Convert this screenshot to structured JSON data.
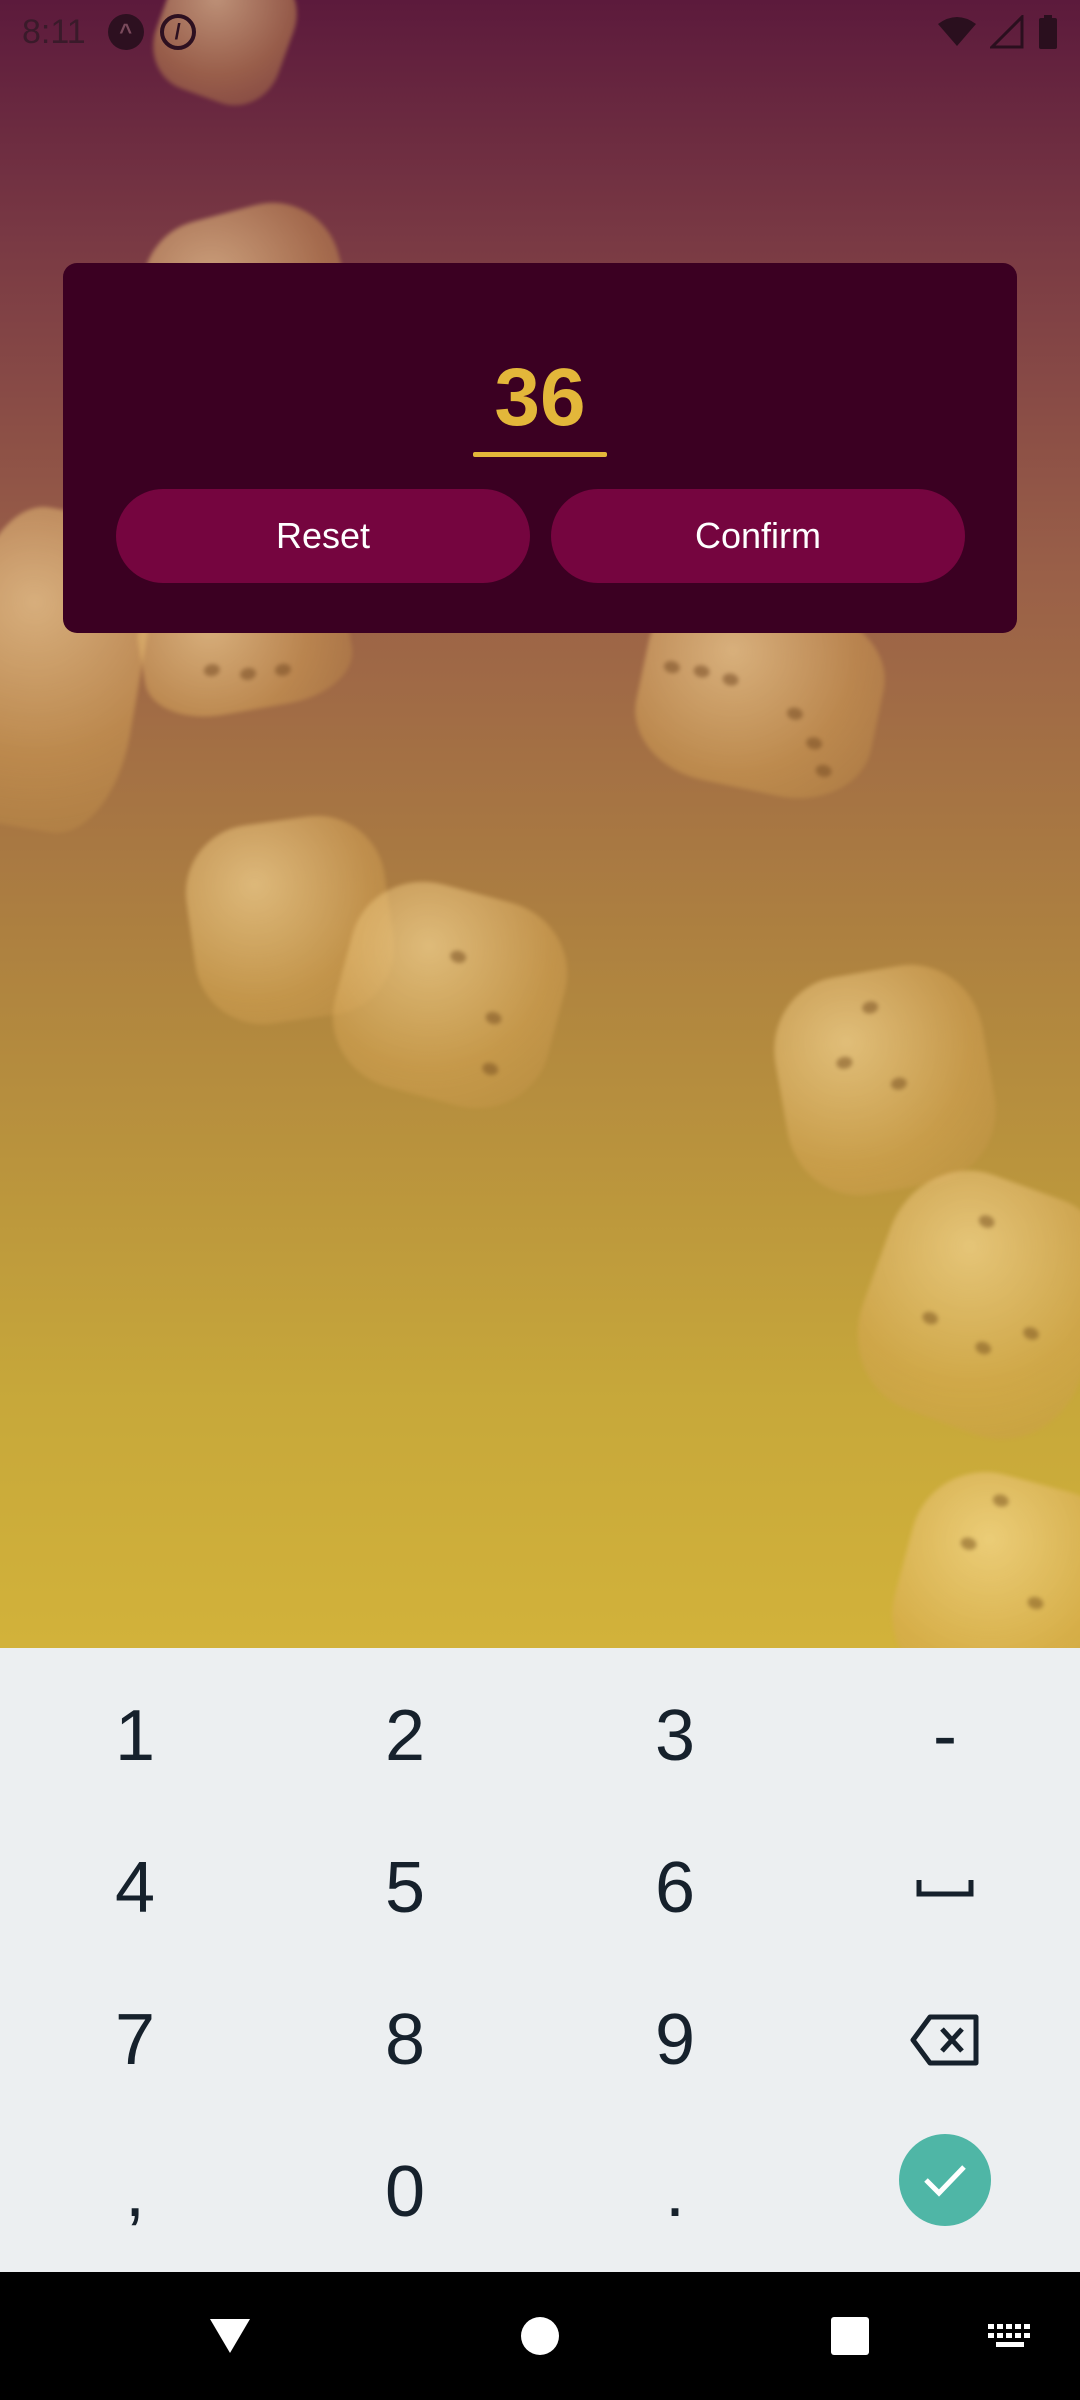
{
  "status_bar": {
    "time": "8:11",
    "icons": [
      "app-notification-icon",
      "do-not-disturb-icon",
      "wifi-icon",
      "signal-icon",
      "battery-icon"
    ]
  },
  "dialog": {
    "value": "36",
    "reset_label": "Reset",
    "confirm_label": "Confirm"
  },
  "keyboard": {
    "row1": [
      "1",
      "2",
      "3",
      "-"
    ],
    "row2": [
      "4",
      "5",
      "6"
    ],
    "row3": [
      "7",
      "8",
      "9"
    ],
    "row4": [
      ",",
      "0",
      "."
    ]
  },
  "nav_bar": {
    "icons": [
      "back-icon",
      "home-icon",
      "recents-icon",
      "keyboard-switch-icon"
    ]
  },
  "colors": {
    "dialog_bg": "#3b0022",
    "accent": "#e3b73a",
    "button": "#75053f",
    "done_key": "#4fb6a6"
  }
}
